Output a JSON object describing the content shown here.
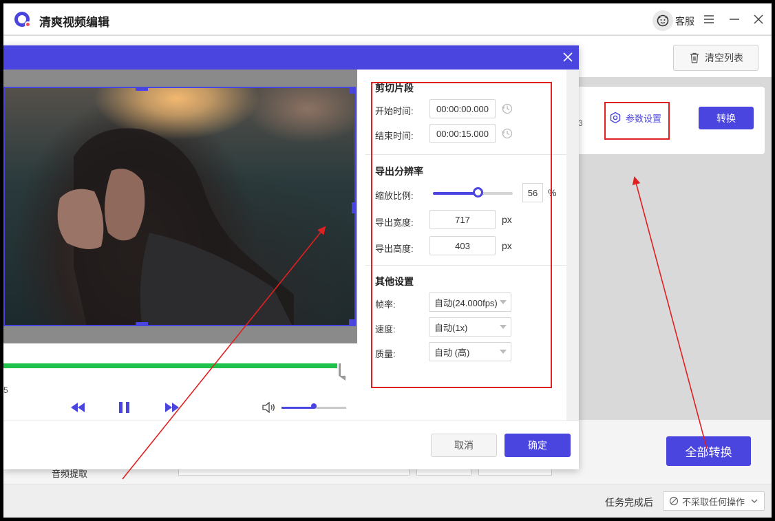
{
  "app": {
    "title": "清爽视频编辑",
    "service_label": "客服"
  },
  "main": {
    "clear_list_label": "清空列表",
    "card_digit": "3",
    "param_settings_label": "参数设置",
    "convert_label": "转换",
    "convert_all_label": "全部转换",
    "audio_extract_label": "音频提取",
    "after_task_label": "任务完成后",
    "after_task_value": "不采取任何操作"
  },
  "dialog": {
    "player": {
      "time_fragment": "5",
      "progress": 0.97,
      "volume": 0.5
    },
    "cut": {
      "title": "剪切片段",
      "start_label": "开始时间:",
      "start_value": "00:00:00.000",
      "end_label": "结束时间:",
      "end_value": "00:00:15.000"
    },
    "resolution": {
      "title": "导出分辨率",
      "scale_label": "缩放比例:",
      "scale_value": "56",
      "scale_unit": "%",
      "width_label": "导出宽度:",
      "width_value": "717",
      "height_label": "导出高度:",
      "height_value": "403",
      "unit": "px"
    },
    "other": {
      "title": "其他设置",
      "fps_label": "帧率:",
      "fps_value": "自动(24.000fps)",
      "speed_label": "速度:",
      "speed_value": "自动(1x)",
      "quality_label": "质量:",
      "quality_value": "自动 (高)"
    },
    "cancel_label": "取消",
    "ok_label": "确定"
  },
  "colors": {
    "accent": "#4b45e0",
    "progress": "#1fc24a",
    "annotation": "#e02020"
  }
}
